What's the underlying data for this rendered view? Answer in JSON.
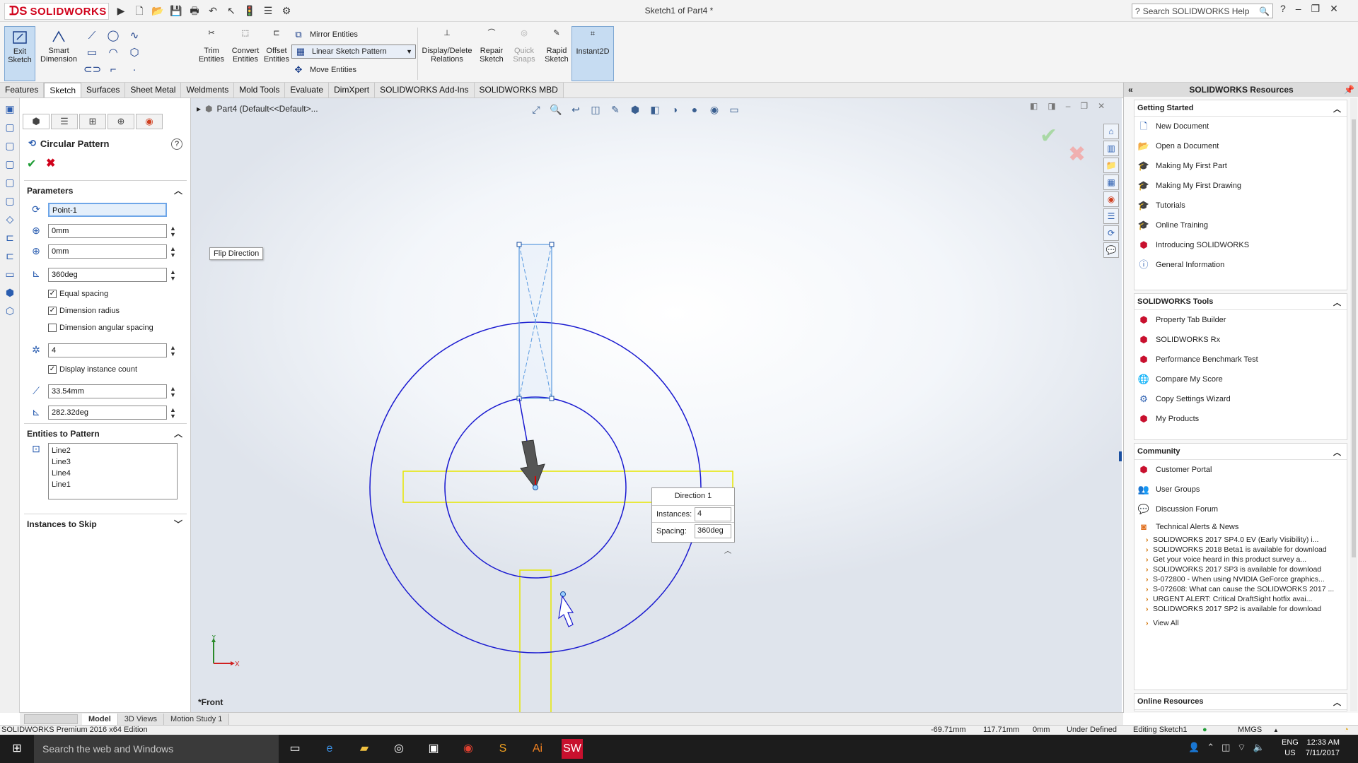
{
  "titlebar": {
    "app_name": "SOLIDWORKS",
    "document_title": "Sketch1 of Part4 *",
    "search_placeholder": "Search SOLIDWORKS Help",
    "help_label": "?"
  },
  "command_manager": {
    "exit_sketch": "Exit Sketch",
    "smart_dimension": "Smart Dimension",
    "trim_entities": "Trim Entities",
    "convert_entities": "Convert Entities",
    "offset_entities": "Offset Entities",
    "mirror_entities": "Mirror Entities",
    "linear_sketch_pattern": "Linear Sketch Pattern",
    "move_entities": "Move Entities",
    "display_delete_relations": "Display/Delete Relations",
    "repair_sketch": "Repair Sketch",
    "quick_snaps": "Quick Snaps",
    "rapid_sketch": "Rapid Sketch",
    "instant2d": "Instant2D"
  },
  "tabs": [
    "Features",
    "Sketch",
    "Surfaces",
    "Sheet Metal",
    "Weldments",
    "Mold Tools",
    "Evaluate",
    "DimXpert",
    "SOLIDWORKS Add-Ins",
    "SOLIDWORKS MBD"
  ],
  "active_tab": "Sketch",
  "property_manager": {
    "title": "Circular Pattern",
    "help": "?",
    "parameters_header": "Parameters",
    "center_point": "Point-1",
    "center_x": "0mm",
    "center_y": "0mm",
    "angle": "360deg",
    "equal_spacing": "Equal spacing",
    "dimension_radius": "Dimension radius",
    "dimension_angular_spacing": "Dimension angular spacing",
    "instances": "4",
    "display_instance_count": "Display instance count",
    "radius": "33.54mm",
    "arc_angle": "282.32deg",
    "entities_header": "Entities to Pattern",
    "entities": [
      "Line2",
      "Line3",
      "Line4",
      "Line1"
    ],
    "instances_to_skip_header": "Instances to Skip"
  },
  "graphics": {
    "tree_label": "Part4  (Default<<Default>...",
    "flip_direction_tooltip": "Flip Direction",
    "direction_box": {
      "title": "Direction 1",
      "instances_label": "Instances:",
      "instances_value": "4",
      "spacing_label": "Spacing:",
      "spacing_value": "360deg"
    },
    "view_name": "*Front",
    "axis_x": "X",
    "axis_y": "Y"
  },
  "taskpane": {
    "header": "SOLIDWORKS Resources",
    "getting_started": {
      "title": "Getting Started",
      "items": [
        "New Document",
        "Open a Document",
        "Making My First Part",
        "Making My First Drawing",
        "Tutorials",
        "Online Training",
        "Introducing SOLIDWORKS",
        "General Information"
      ]
    },
    "tools": {
      "title": "SOLIDWORKS Tools",
      "items": [
        "Property Tab Builder",
        "SOLIDWORKS Rx",
        "Performance Benchmark Test",
        "Compare My Score",
        "Copy Settings Wizard",
        "My Products"
      ]
    },
    "community": {
      "title": "Community",
      "items": [
        "Customer Portal",
        "User Groups",
        "Discussion Forum",
        "Technical Alerts & News"
      ],
      "news": [
        "SOLIDWORKS 2017 SP4.0 EV (Early Visibility) i...",
        "SOLIDWORKS 2018 Beta1 is available for download",
        "Get your voice heard in this product survey a...",
        "SOLIDWORKS 2017 SP3 is available for download",
        "S-072800 - When using NVIDIA GeForce graphics...",
        "S-072608: What can cause the SOLIDWORKS 2017 ...",
        "URGENT ALERT: Critical DraftSight hotfix avai...",
        "SOLIDWORKS 2017 SP2 is available for download"
      ],
      "view_all": "View All"
    },
    "online_resources": "Online Resources"
  },
  "bottom_tabs": [
    "Model",
    "3D Views",
    "Motion Study 1"
  ],
  "status_bar": {
    "edition": "SOLIDWORKS Premium 2016 x64 Edition",
    "x": "-69.71mm",
    "y": "117.71mm",
    "z": "0mm",
    "state": "Under Defined",
    "editing": "Editing Sketch1",
    "units": "MMGS"
  },
  "taskbar": {
    "search_placeholder": "Search the web and Windows",
    "lang_1": "ENG",
    "lang_2": "US",
    "time": "12:33 AM",
    "date": "7/11/2017"
  }
}
